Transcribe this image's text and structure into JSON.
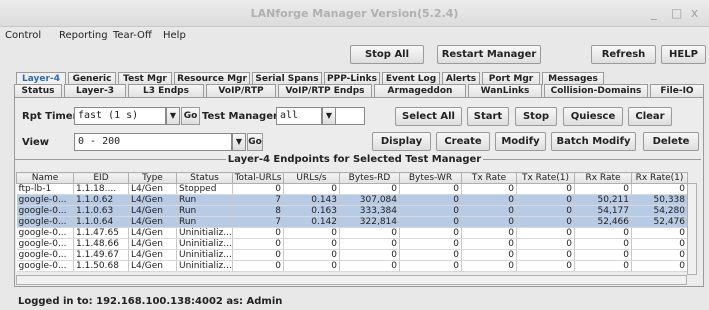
{
  "window": {
    "title": "LANforge Manager   Version(5.2.4)",
    "minimize_glyph": "_",
    "maximize_glyph": "□",
    "close_glyph": "x"
  },
  "menu": [
    "Control",
    "Reporting",
    "Tear-Off",
    "Help"
  ],
  "top_buttons": {
    "stop_all": "Stop All",
    "restart_manager": "Restart Manager",
    "refresh": "Refresh",
    "help": "HELP"
  },
  "tabs_row1": [
    "Layer-4",
    "Generic",
    "Test Mgr",
    "Resource Mgr",
    "Serial Spans",
    "PPP-Links",
    "Event Log",
    "Alerts",
    "Port Mgr",
    "Messages"
  ],
  "tabs_row2": [
    "Status",
    "Layer-3",
    "L3 Endps",
    "VoIP/RTP",
    "VoIP/RTP Endps",
    "Armageddon",
    "WanLinks",
    "Collision-Domains",
    "File-IO"
  ],
  "active_tab": "Layer-4",
  "controls": {
    "rpt_timer_label": "Rpt Timer:",
    "rpt_timer_value": "fast     (1 s)",
    "go_label": "Go",
    "test_manager_label": "Test Manager",
    "test_manager_value": "all",
    "view_label": "View",
    "view_value": "0 - 200",
    "buttons_row1": [
      "Select All",
      "Start",
      "Stop",
      "Quiesce",
      "Clear"
    ],
    "buttons_row2": [
      "Display",
      "Create",
      "Modify",
      "Batch Modify",
      "Delete"
    ]
  },
  "table": {
    "title": "Layer-4 Endpoints for Selected Test Manager",
    "columns": [
      "Name",
      "EID",
      "Type",
      "Status",
      "Total-URLs",
      "URLs/s",
      "Bytes-RD",
      "Bytes-WR",
      "Tx Rate",
      "Tx Rate(1)",
      "Rx Rate",
      "Rx Rate(1)"
    ],
    "rows": [
      {
        "selected": false,
        "cells": [
          "ftp-lb-1",
          "1.1.18....",
          "L4/Gen",
          "Stopped",
          "0",
          "0",
          "0",
          "0",
          "0",
          "0",
          "0",
          "0"
        ]
      },
      {
        "selected": true,
        "cells": [
          "google-0...",
          "1.1.0.62",
          "L4/Gen",
          "Run",
          "7",
          "0.143",
          "307,084",
          "0",
          "0",
          "0",
          "50,211",
          "50,338"
        ]
      },
      {
        "selected": true,
        "cells": [
          "google-0...",
          "1.1.0.63",
          "L4/Gen",
          "Run",
          "8",
          "0.163",
          "333,384",
          "0",
          "0",
          "0",
          "54,177",
          "54,280"
        ]
      },
      {
        "selected": true,
        "cells": [
          "google-0...",
          "1.1.0.64",
          "L4/Gen",
          "Run",
          "7",
          "0.142",
          "322,814",
          "0",
          "0",
          "0",
          "52,466",
          "52,476"
        ]
      },
      {
        "selected": false,
        "cells": [
          "google-0...",
          "1.1.47.65",
          "L4/Gen",
          "Uninitializ...",
          "0",
          "0",
          "0",
          "0",
          "0",
          "0",
          "0",
          "0"
        ]
      },
      {
        "selected": false,
        "cells": [
          "google-0...",
          "1.1.48.66",
          "L4/Gen",
          "Uninitializ...",
          "0",
          "0",
          "0",
          "0",
          "0",
          "0",
          "0",
          "0"
        ]
      },
      {
        "selected": false,
        "cells": [
          "google-0...",
          "1.1.49.67",
          "L4/Gen",
          "Uninitializ...",
          "0",
          "0",
          "0",
          "0",
          "0",
          "0",
          "0",
          "0"
        ]
      },
      {
        "selected": false,
        "cells": [
          "google-0...",
          "1.1.50.68",
          "L4/Gen",
          "Uninitializ...",
          "0",
          "0",
          "0",
          "0",
          "0",
          "0",
          "0",
          "0"
        ]
      }
    ]
  },
  "status_bar": {
    "text": "Logged in to:  192.168.100.138:4002  as:  Admin"
  },
  "colors": {
    "selected_row": "#b8cbe6",
    "active_tab_text": "#2f6bb0"
  }
}
